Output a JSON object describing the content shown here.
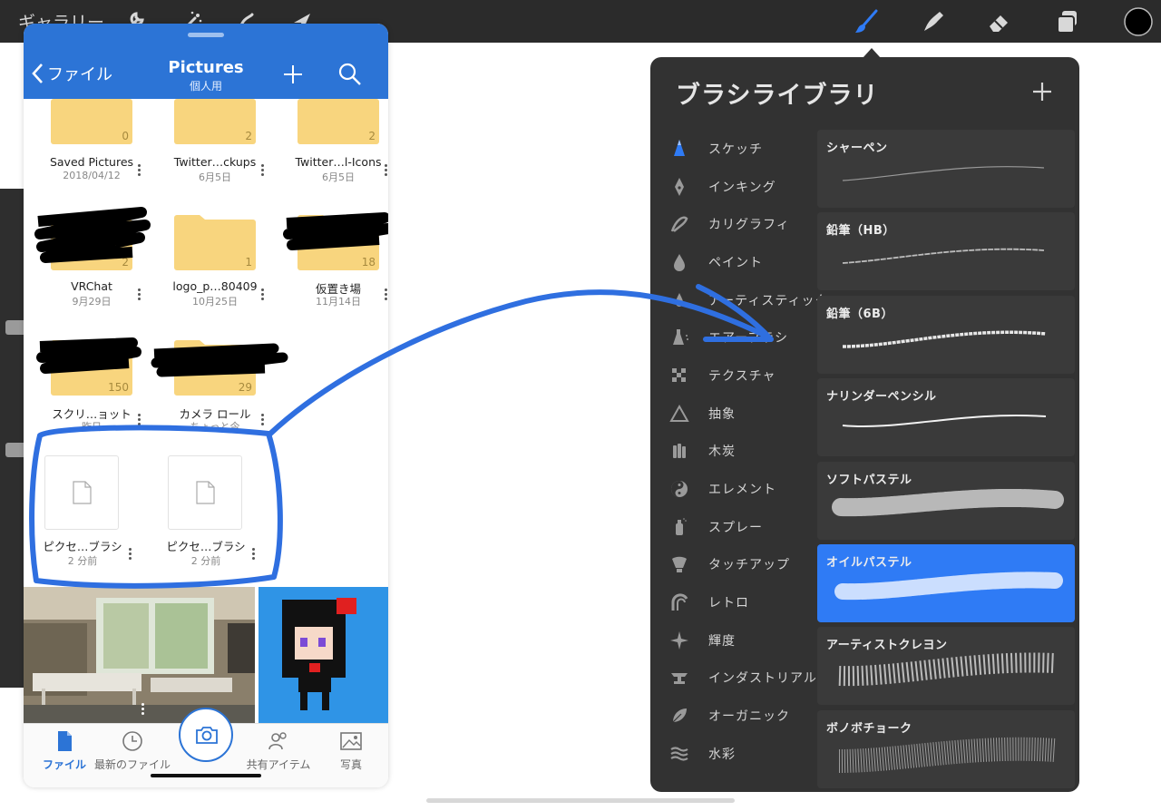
{
  "procreate": {
    "gallery_label": "ギャラリー",
    "toolbar_icons": [
      "wrench-icon",
      "magic-wand-icon",
      "selection-icon",
      "transform-arrow-icon",
      "brush-icon",
      "smudge-icon",
      "eraser-icon",
      "layers-icon",
      "color-swatch-icon"
    ],
    "accent": "#2f7bf5"
  },
  "brush_library": {
    "title": "ブラシライブラリ",
    "categories": [
      {
        "label": "スケッチ",
        "icon": "pencil-tip-icon"
      },
      {
        "label": "インキング",
        "icon": "pen-nib-icon"
      },
      {
        "label": "カリグラフィ",
        "icon": "calligraphy-stroke-icon"
      },
      {
        "label": "ペイント",
        "icon": "paint-drop-icon"
      },
      {
        "label": "アーティスティック",
        "icon": "flame-drop-icon"
      },
      {
        "label": "エアーブラシ",
        "icon": "airbrush-icon"
      },
      {
        "label": "テクスチャ",
        "icon": "checker-texture-icon"
      },
      {
        "label": "抽象",
        "icon": "triangle-icon"
      },
      {
        "label": "木炭",
        "icon": "charcoal-icon"
      },
      {
        "label": "エレメント",
        "icon": "yin-yang-icon"
      },
      {
        "label": "スプレー",
        "icon": "spray-can-icon"
      },
      {
        "label": "タッチアップ",
        "icon": "touchup-icon"
      },
      {
        "label": "レトロ",
        "icon": "retro-arc-icon"
      },
      {
        "label": "輝度",
        "icon": "sparkle-icon"
      },
      {
        "label": "インダストリアル",
        "icon": "anvil-icon"
      },
      {
        "label": "オーガニック",
        "icon": "leaf-icon"
      },
      {
        "label": "水彩",
        "icon": "water-waves-icon"
      }
    ],
    "brushes": [
      {
        "name": "シャーペン"
      },
      {
        "name": "鉛筆（HB）"
      },
      {
        "name": "鉛筆（6B）"
      },
      {
        "name": "ナリンダーペンシル"
      },
      {
        "name": "ソフトパステル"
      },
      {
        "name": "オイルパステル",
        "selected": true
      },
      {
        "name": "アーティストクレヨン"
      },
      {
        "name": "ボノボチョーク"
      }
    ]
  },
  "files_app": {
    "back_label": "ファイル",
    "title": "Pictures",
    "subtitle": "個人用",
    "items": [
      {
        "name": "Saved Pictures",
        "date": "2018/04/12",
        "count": "0",
        "kind": "folder"
      },
      {
        "name": "Twitter…ckups",
        "date": "6月5日",
        "count": "2",
        "kind": "folder"
      },
      {
        "name": "Twitter…l-Icons",
        "date": "6月5日",
        "count": "2",
        "kind": "folder"
      },
      {
        "name": "VRChat",
        "date": "9月29日",
        "count": "2",
        "kind": "folder"
      },
      {
        "name": "logo_p…80409",
        "date": "10月25日",
        "count": "1",
        "kind": "folder"
      },
      {
        "name": "仮置き場",
        "date": "11月14日",
        "count": "18",
        "kind": "folder"
      },
      {
        "name": "スクリ…ョット",
        "date": "昨日",
        "count": "150",
        "kind": "folder"
      },
      {
        "name": "カメラ ロール",
        "date": "ちょっと今",
        "count": "29",
        "kind": "folder"
      },
      {
        "name": "ピクセ…ブラシ",
        "date": "2 分前",
        "kind": "file"
      },
      {
        "name": "ピクセ…ブラシ",
        "date": "2 分前",
        "kind": "file"
      }
    ],
    "tabs": [
      {
        "label": "ファイル",
        "icon": "file-icon",
        "active": true
      },
      {
        "label": "最新のファイル",
        "icon": "clock-icon"
      },
      {
        "label": "",
        "icon": "camera-icon"
      },
      {
        "label": "共有アイテム",
        "icon": "shared-people-icon"
      },
      {
        "label": "写真",
        "icon": "photo-icon"
      }
    ],
    "accent": "#2c74d6"
  },
  "annotation": {
    "color": "#2f6fe0"
  }
}
